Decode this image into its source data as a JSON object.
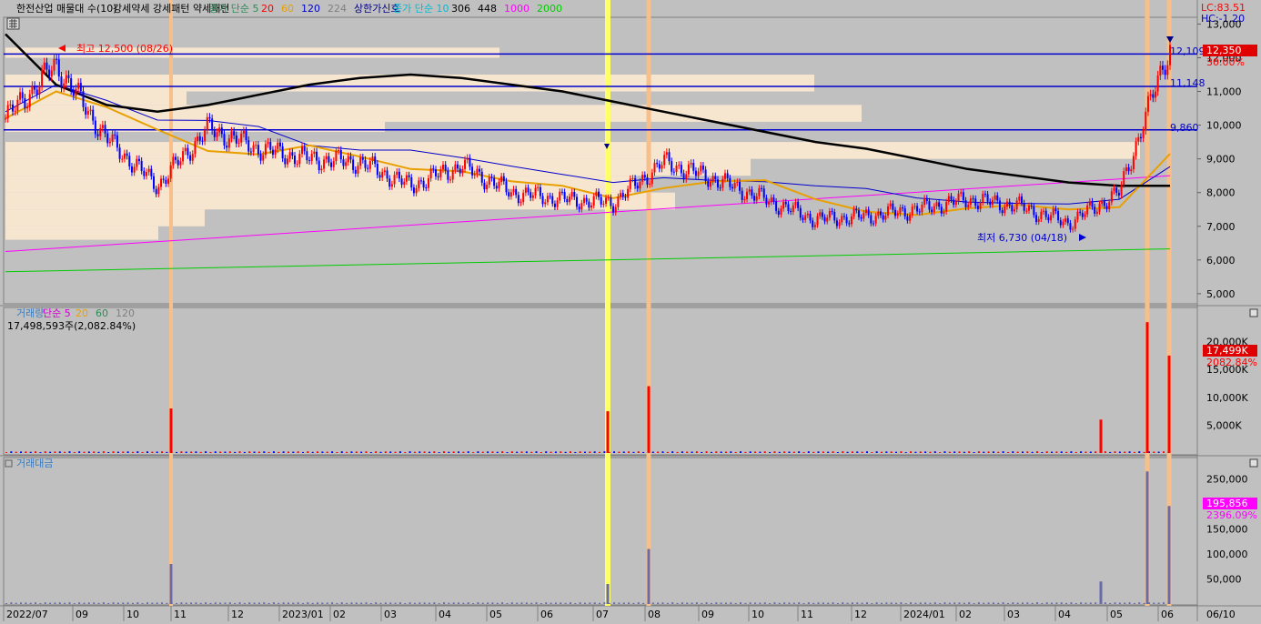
{
  "price_panel": {
    "legend": [
      {
        "text": "한전산업 매물대 수(10)",
        "color": "#000000"
      },
      {
        "text": "강세약세 강세패턴 약세패턴",
        "color": "#000000"
      },
      {
        "text": "종가 단순 5",
        "color": "#2e8b57"
      },
      {
        "text": "20",
        "color": "#ff0000"
      },
      {
        "text": "60",
        "color": "#e8a000"
      },
      {
        "text": "120",
        "color": "#0000cc"
      },
      {
        "text": "224",
        "color": "#808080"
      },
      {
        "text": "상한가신호",
        "color": "#000080"
      },
      {
        "text": "종가 단순 10",
        "color": "#00bcd4"
      },
      {
        "text": "306",
        "color": "#000000"
      },
      {
        "text": "448",
        "color": "#000000"
      },
      {
        "text": "1000",
        "color": "#ff00ff"
      },
      {
        "text": "2000",
        "color": "#00cc00"
      }
    ],
    "lc_label": "LC:83.51",
    "hc_label": "HC:-1.20",
    "high_annotation": "최고 12,500 (08/26)",
    "low_annotation": "최저 6,730 (04/18)",
    "hline_labels": [
      "12,109",
      "11,148",
      "9,860"
    ],
    "current_price": "12,350",
    "current_change": "30.00%",
    "y_ticks": [
      "13,000",
      "12,000",
      "11,000",
      "10,000",
      "9,000",
      "8,000",
      "7,000",
      "6,000",
      "5,000"
    ]
  },
  "volume_panel": {
    "legend": [
      {
        "text": "거래량",
        "color": "#3a7bbf"
      },
      {
        "text": "단순 5",
        "color": "#cc00cc"
      },
      {
        "text": "20",
        "color": "#e8a000"
      },
      {
        "text": "60",
        "color": "#2e8b57"
      },
      {
        "text": "120",
        "color": "#808080"
      }
    ],
    "info": "17,498,593주(2,082.84%)",
    "current_label": "17,499K",
    "current_pct": "2082.84%",
    "y_ticks": [
      "20,000K",
      "15,000K",
      "10,000K",
      "5,000K"
    ]
  },
  "amount_panel": {
    "legend": "거래대금",
    "current_label": "195,856",
    "current_pct": "2396.09%",
    "y_ticks": [
      "250,000",
      "200,000",
      "150,000",
      "100,000",
      "50,000"
    ]
  },
  "x_axis": {
    "labels": [
      "2022/07",
      "09",
      "10",
      "11",
      "12",
      "2023/01",
      "02",
      "03",
      "04",
      "05",
      "06",
      "07",
      "08",
      "09",
      "10",
      "11",
      "12",
      "2024/01",
      "02",
      "03",
      "04",
      "05",
      "06"
    ],
    "date_box": "06/10"
  },
  "colors": {
    "up": "#ff0000",
    "down": "#0000ff",
    "panel": "#c0c0c0",
    "profile": "#f6e6d0",
    "hline": "#0000cc",
    "ma224": "#000000"
  },
  "chart_data": [
    {
      "type": "candlestick",
      "title": "한전산업",
      "ylim": [
        4700,
        13200
      ],
      "x": [
        "2022/07",
        "2022/08",
        "2022/09",
        "2022/10",
        "2022/11",
        "2022/12",
        "2023/01",
        "2023/02",
        "2023/03",
        "2023/04",
        "2023/05",
        "2023/06",
        "2023/07",
        "2023/08",
        "2023/09",
        "2023/10",
        "2023/11",
        "2023/12",
        "2024/01",
        "2024/02",
        "2024/03",
        "2024/04",
        "2024/05",
        "2024/06"
      ],
      "series": [
        {
          "name": "종가",
          "values": [
            10200,
            11800,
            9600,
            8200,
            9900,
            9300,
            9000,
            8900,
            8200,
            8800,
            8000,
            7800,
            7700,
            8900,
            8400,
            7800,
            7200,
            7300,
            7500,
            7800,
            7600,
            7100,
            8000,
            12350
          ]
        },
        {
          "name": "224",
          "values": [
            12700,
            11200,
            10600,
            10400,
            10600,
            10900,
            11200,
            11400,
            11500,
            11400,
            11200,
            11000,
            10700,
            10400,
            10100,
            9800,
            9500,
            9300,
            9000,
            8700,
            8500,
            8300,
            8200,
            8200
          ]
        }
      ],
      "horizontal_levels": [
        12109,
        11148,
        9860
      ],
      "trend_lines": [
        {
          "name": "1000",
          "from": [
            2022.5,
            6250
          ],
          "to": [
            2024.45,
            8500
          ]
        },
        {
          "name": "2000",
          "from": [
            2022.5,
            5650
          ],
          "to": [
            2024.45,
            6330
          ]
        }
      ],
      "annotations": [
        {
          "text": "최고 12,500 (08/26)",
          "value": 12500
        },
        {
          "text": "최저 6,730 (04/18)",
          "value": 6730
        }
      ]
    },
    {
      "type": "bar",
      "title": "거래량",
      "ylim": [
        0,
        25000
      ],
      "spikes": [
        {
          "x": "2022/11",
          "value": 8000
        },
        {
          "x": "2023/07",
          "value": 7500
        },
        {
          "x": "2023/08",
          "value": 12000
        },
        {
          "x": "2024/05",
          "value": 6000
        },
        {
          "x": "2024/06",
          "value": 23500
        },
        {
          "x": "2024/06",
          "value": 17499
        }
      ]
    },
    {
      "type": "bar",
      "title": "거래대금",
      "ylim": [
        0,
        280000
      ],
      "spikes": [
        {
          "x": "2022/11",
          "value": 80000
        },
        {
          "x": "2023/07",
          "value": 40000
        },
        {
          "x": "2023/08",
          "value": 110000
        },
        {
          "x": "2024/05",
          "value": 45000
        },
        {
          "x": "2024/06",
          "value": 265000
        },
        {
          "x": "2024/06",
          "value": 195856
        }
      ]
    }
  ]
}
